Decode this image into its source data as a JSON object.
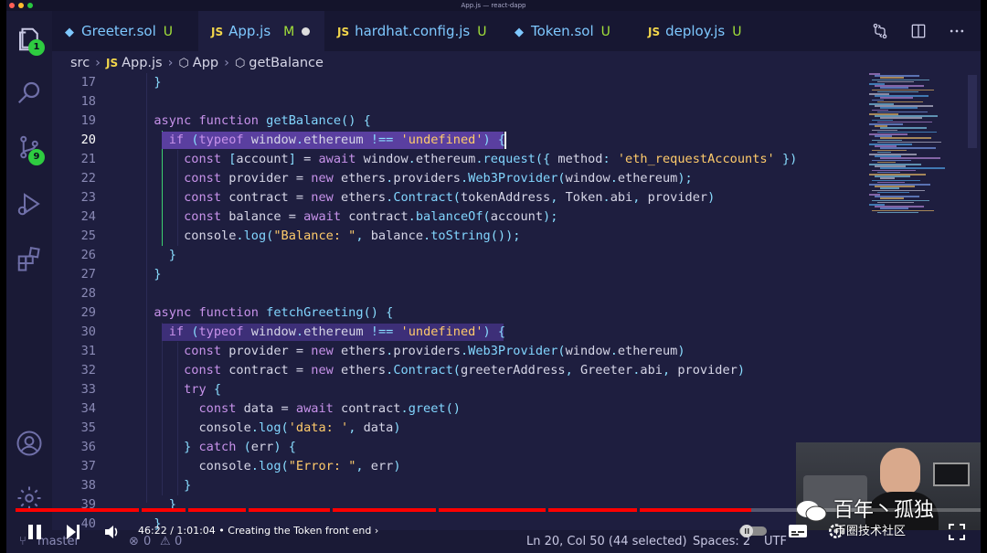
{
  "window": {
    "title": "App.js — react-dapp"
  },
  "tabs": [
    {
      "label": "Greeter.sol",
      "status": "U",
      "type": "sol"
    },
    {
      "label": "App.js",
      "status": "M",
      "type": "js",
      "active": true,
      "modified": true
    },
    {
      "label": "hardhat.config.js",
      "status": "U",
      "type": "js"
    },
    {
      "label": "Token.sol",
      "status": "U",
      "type": "sol"
    },
    {
      "label": "deploy.js",
      "status": "U",
      "type": "js"
    }
  ],
  "badges": {
    "explorer": "1",
    "source_control": "9"
  },
  "breadcrumb": {
    "folder": "src",
    "file": "App.js",
    "symbol1": "App",
    "symbol2": "getBalance",
    "js_tag": "JS"
  },
  "code": {
    "lines": [
      {
        "n": "17",
        "text": "  }"
      },
      {
        "n": "18",
        "text": ""
      },
      {
        "n": "19",
        "text": "  async function getBalance() {"
      },
      {
        "n": "20",
        "text": "    if (typeof window.ethereum !== 'undefined') {"
      },
      {
        "n": "21",
        "text": "      const [account] = await window.ethereum.request({ method: 'eth_requestAccounts' })"
      },
      {
        "n": "22",
        "text": "      const provider = new ethers.providers.Web3Provider(window.ethereum);"
      },
      {
        "n": "23",
        "text": "      const contract = new ethers.Contract(tokenAddress, Token.abi, provider)"
      },
      {
        "n": "24",
        "text": "      const balance = await contract.balanceOf(account);"
      },
      {
        "n": "25",
        "text": "      console.log(\"Balance: \", balance.toString());"
      },
      {
        "n": "26",
        "text": "    }"
      },
      {
        "n": "27",
        "text": "  }"
      },
      {
        "n": "28",
        "text": ""
      },
      {
        "n": "29",
        "text": "  async function fetchGreeting() {"
      },
      {
        "n": "30",
        "text": "    if (typeof window.ethereum !== 'undefined') {"
      },
      {
        "n": "31",
        "text": "      const provider = new ethers.providers.Web3Provider(window.ethereum)"
      },
      {
        "n": "32",
        "text": "      const contract = new ethers.Contract(greeterAddress, Greeter.abi, provider)"
      },
      {
        "n": "33",
        "text": "      try {"
      },
      {
        "n": "34",
        "text": "        const data = await contract.greet()"
      },
      {
        "n": "35",
        "text": "        console.log('data: ', data)"
      },
      {
        "n": "36",
        "text": "      } catch (err) {"
      },
      {
        "n": "37",
        "text": "        console.log(\"Error: \", err)"
      },
      {
        "n": "38",
        "text": "      }"
      },
      {
        "n": "39",
        "text": "    }"
      },
      {
        "n": "40",
        "text": "  }"
      }
    ],
    "current_line": "20"
  },
  "player": {
    "time": "46:22 / 1:01:04",
    "chapter": "Creating the Token front end",
    "progress": 0.762
  },
  "statusbar": {
    "branch": "master",
    "errors": "0",
    "warnings": "0",
    "position": "Ln 20, Col 50 (44 selected)",
    "spaces": "Spaces: 2",
    "encoding": "UTF"
  },
  "watermark": {
    "line1": "百年丶孤独",
    "line2": "币圈技术社区"
  },
  "colors": {
    "accent_green": "#2ecc40",
    "progress_red": "#ff0000",
    "selection": "#5a3fa0",
    "background": "#1e1e3f"
  }
}
